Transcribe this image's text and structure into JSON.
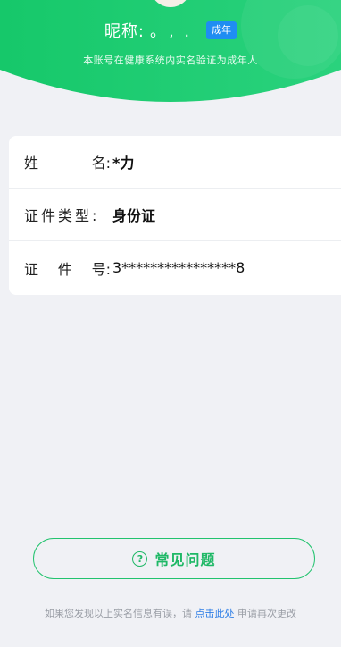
{
  "header": {
    "nickname_label": "昵称:",
    "nickname_value": "。, .",
    "age_badge": "成年",
    "subtitle": "本账号在健康系统内实名验证为成年人"
  },
  "identity": {
    "rows": [
      {
        "label_a": "姓",
        "label_b": "名:",
        "value": "*力"
      },
      {
        "label": "证件类型:",
        "value": "身份证"
      },
      {
        "label_a": "证",
        "label_m": "件",
        "label_b": "号:",
        "value": "3****************8"
      }
    ]
  },
  "faq_button": {
    "label": "常见问题",
    "icon": "help-circle-icon"
  },
  "footer": {
    "text_before": "如果您发现以上实名信息有误，请",
    "link": "点击此处",
    "text_after": "申请再次更改"
  },
  "colors": {
    "brand_green": "#1fc872",
    "background": "#f0f1f5",
    "badge_blue": "#1f8df2",
    "link_blue": "#2f7fe6"
  }
}
